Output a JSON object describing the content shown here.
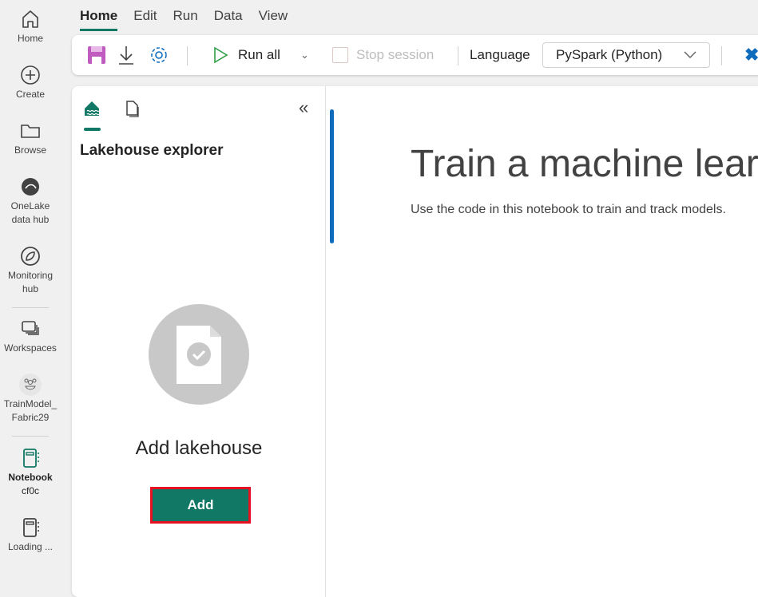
{
  "rail": {
    "items": [
      {
        "label": "Home",
        "icon": "home-icon"
      },
      {
        "label": "Create",
        "icon": "plus-circle-icon"
      },
      {
        "label": "Browse",
        "icon": "folder-icon"
      },
      {
        "label": "OneLake data hub",
        "line1": "OneLake",
        "line2": "data hub",
        "icon": "onelake-icon"
      },
      {
        "label": "Monitoring hub",
        "line1": "Monitoring",
        "line2": "hub",
        "icon": "monitoring-icon"
      },
      {
        "label": "Workspaces",
        "icon": "workspaces-icon"
      },
      {
        "label": "TrainModel_Fabric29",
        "line1": "TrainModel_",
        "line2": "Fabric29",
        "icon": "workspace-avatar-icon"
      },
      {
        "label": "Notebook cf0c",
        "line1": "Notebook",
        "line2": "cf0c",
        "icon": "notebook-icon"
      },
      {
        "label": "Loading ...",
        "icon": "notebook-icon"
      }
    ]
  },
  "menu": {
    "tabs": [
      "Home",
      "Edit",
      "Run",
      "Data",
      "View"
    ],
    "active": "Home"
  },
  "toolbar": {
    "run_all": "Run all",
    "stop_session": "Stop session",
    "language_label": "Language",
    "language_value": "PySpark (Python)"
  },
  "explorer": {
    "title": "Lakehouse explorer",
    "empty_title": "Add lakehouse",
    "add_button": "Add"
  },
  "notebook": {
    "title": "Train a machine lear",
    "subtitle": "Use the code in this notebook to train and track models."
  },
  "colors": {
    "accent": "#117865",
    "highlight": "#e81123",
    "scroll": "#0f6cbd"
  }
}
